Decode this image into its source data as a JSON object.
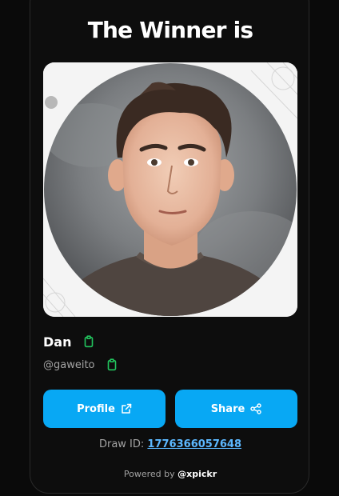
{
  "heading": "The Winner is",
  "winner": {
    "name": "Dan",
    "handle": "@gaweito"
  },
  "buttons": {
    "profile_label": "Profile",
    "share_label": "Share"
  },
  "draw": {
    "label": "Draw ID:",
    "id": "1776366057648"
  },
  "footer": {
    "prefix": "Powered by",
    "brand": "@xpickr"
  },
  "icons": {
    "copy": "clipboard-icon",
    "profile": "external-link-icon",
    "share": "share-icon"
  },
  "colors": {
    "accent": "#08a8f4",
    "copy_icon": "#22c55e",
    "link": "#5cb8ff"
  }
}
